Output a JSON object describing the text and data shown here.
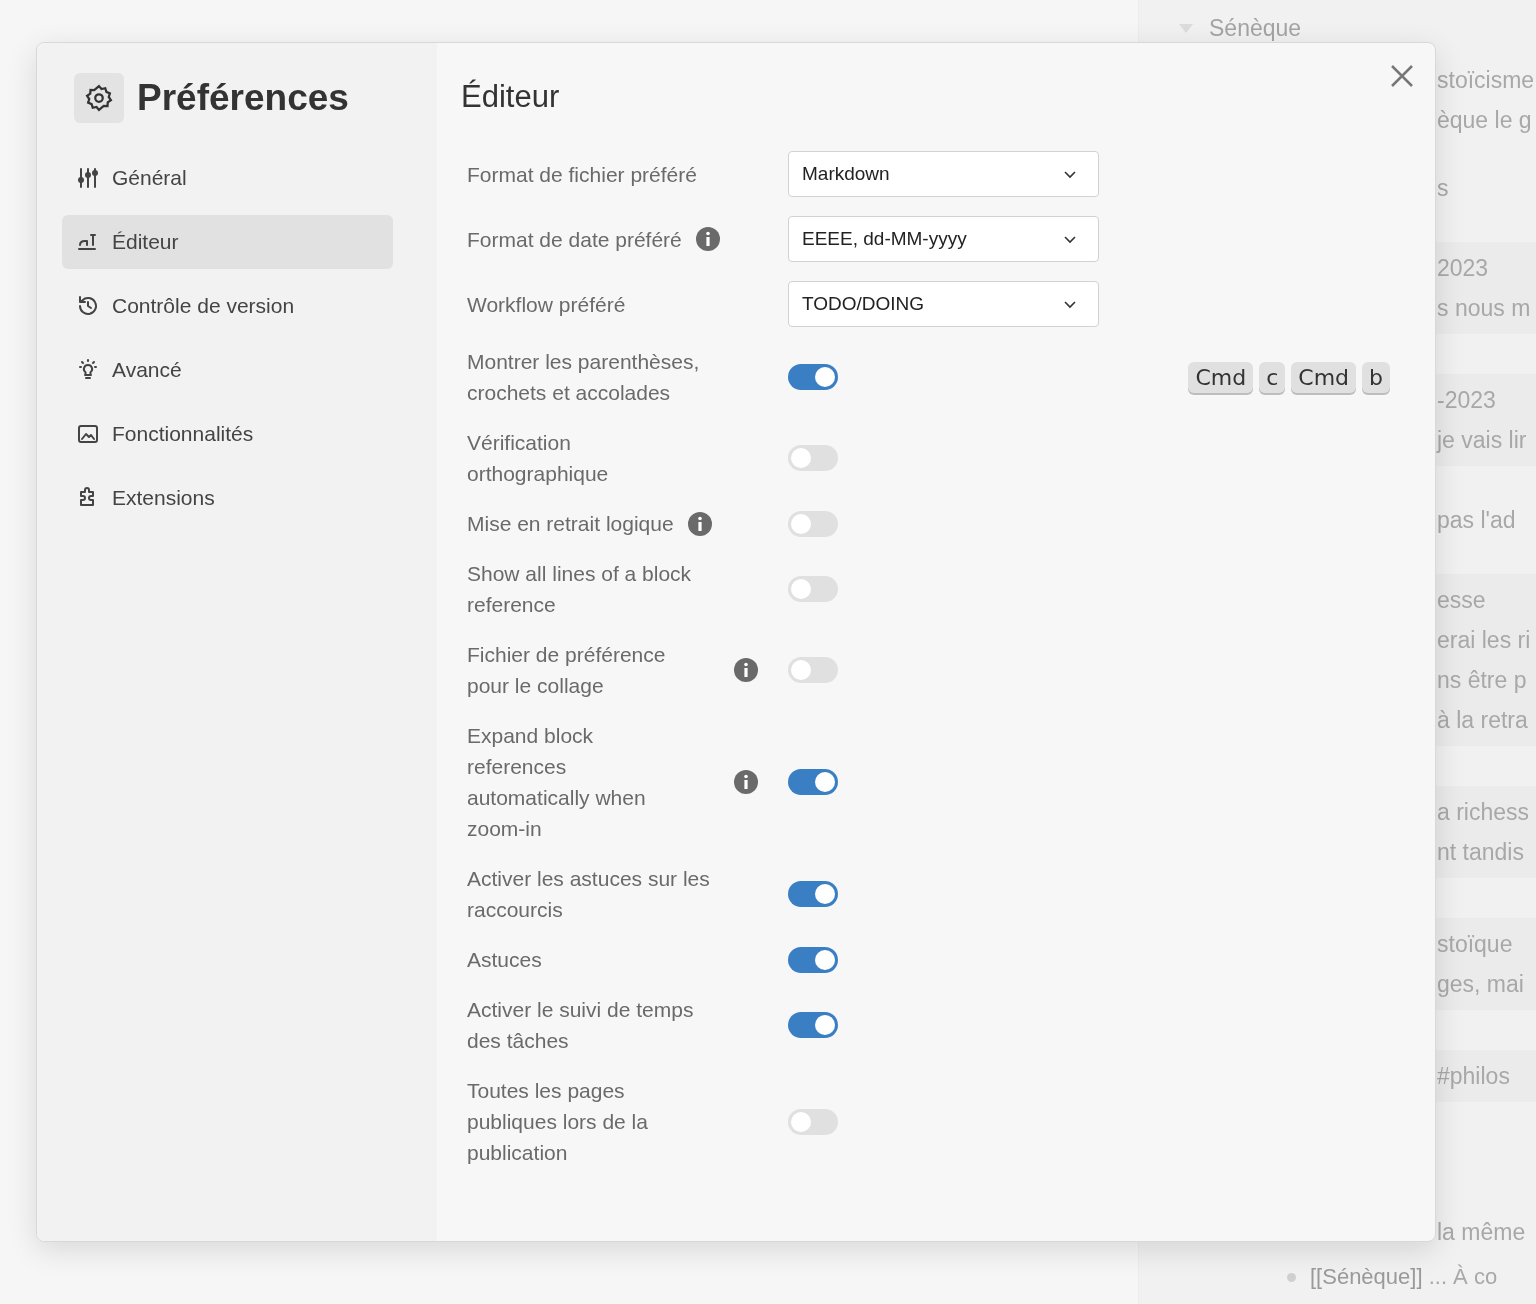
{
  "background": {
    "heading": "Sénèque",
    "blocks": [
      {
        "card": false,
        "lines": [
          "stoïcisme",
          "èque le g"
        ]
      },
      {
        "card": false,
        "lines": [
          "s"
        ]
      },
      {
        "card": true,
        "lines": [
          "2023",
          "s nous m"
        ]
      },
      {
        "card": true,
        "lines": [
          "-2023",
          "je vais lir"
        ]
      },
      {
        "card": false,
        "lines": [
          "pas l'ad"
        ]
      },
      {
        "card": true,
        "lines": [
          "esse",
          "erai les ri",
          "ns être p",
          "à la retra"
        ]
      },
      {
        "card": true,
        "lines": [
          "a richess",
          "nt tandis"
        ]
      },
      {
        "card": true,
        "lines": [
          "stoïque",
          "ges, mai"
        ]
      },
      {
        "card": true,
        "lines": [
          "#philos"
        ]
      },
      {
        "card": false,
        "lines": [
          "la même"
        ]
      }
    ],
    "bullet": {
      "link": "[[Sénèque]]",
      "rest": "... À co"
    }
  },
  "dialog": {
    "title": "Préférences",
    "nav": [
      {
        "label": "Général",
        "selected": false
      },
      {
        "label": "Éditeur",
        "selected": true
      },
      {
        "label": "Contrôle de version",
        "selected": false
      },
      {
        "label": "Avancé",
        "selected": false
      },
      {
        "label": "Fonctionnalités",
        "selected": false
      },
      {
        "label": "Extensions",
        "selected": false
      }
    ],
    "heading": "Éditeur",
    "rows": [
      {
        "kind": "select",
        "label": "Format de fichier préféré",
        "info": false,
        "value": "Markdown"
      },
      {
        "kind": "select",
        "label": "Format de date préféré",
        "info": true,
        "value": "EEEE, dd-MM-yyyy"
      },
      {
        "kind": "select",
        "label": "Workflow préféré",
        "info": false,
        "value": "TODO/DOING"
      },
      {
        "kind": "toggle",
        "label": "Montrer les parenthèses, crochets et accolades",
        "info": false,
        "on": true,
        "shortcut": [
          "Cmd",
          "c",
          "Cmd",
          "b"
        ]
      },
      {
        "kind": "toggle",
        "label": "Vérification orthographique",
        "info": false,
        "on": false
      },
      {
        "kind": "toggle",
        "label": "Mise en retrait logique",
        "info": true,
        "on": false
      },
      {
        "kind": "toggle",
        "label": "Show all lines of a block reference",
        "info": false,
        "on": false
      },
      {
        "kind": "toggle",
        "label": "Fichier de préférence pour le collage",
        "info": true,
        "on": false
      },
      {
        "kind": "toggle",
        "label": "Expand block references automatically when zoom-in",
        "info": true,
        "on": true
      },
      {
        "kind": "toggle",
        "label": "Activer les astuces sur les raccourcis",
        "info": false,
        "on": true
      },
      {
        "kind": "toggle",
        "label": "Astuces",
        "info": false,
        "on": true
      },
      {
        "kind": "toggle",
        "label": "Activer le suivi de temps des tâches",
        "info": false,
        "on": true
      },
      {
        "kind": "toggle",
        "label": "Toutes les pages publiques lors de la publication",
        "info": false,
        "on": false
      }
    ]
  }
}
